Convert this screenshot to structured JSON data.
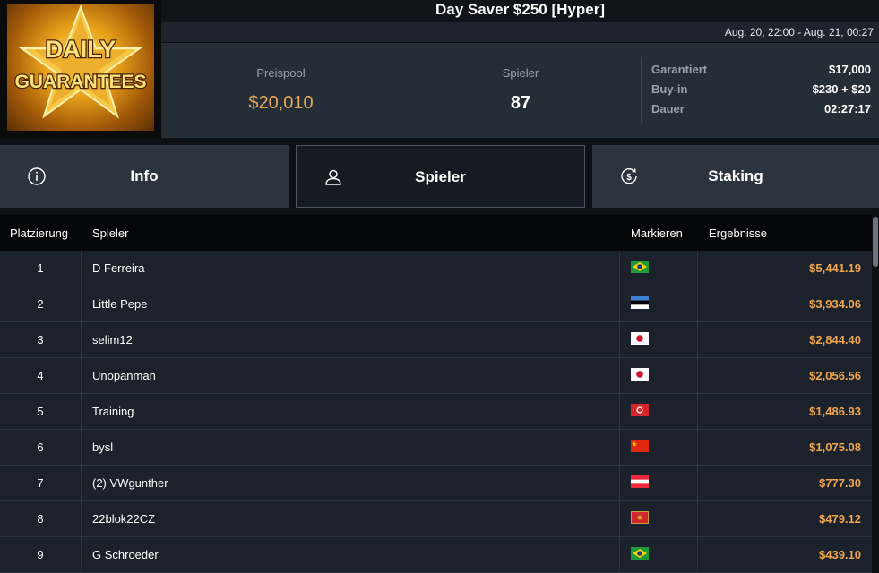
{
  "logo": {
    "line1": "DAILY",
    "line2": "GUARANTEES"
  },
  "title": "Day Saver $250 [Hyper]",
  "date_range": "Aug. 20, 22:00 - Aug. 21, 00:27",
  "stats": {
    "prize_label": "Preispool",
    "prize_value": "$20,010",
    "players_label": "Spieler",
    "players_value": "87"
  },
  "details": [
    {
      "label": "Garantiert",
      "value": "$17,000"
    },
    {
      "label": "Buy-in",
      "value": "$230 + $20"
    },
    {
      "label": "Dauer",
      "value": "02:27:17"
    }
  ],
  "tabs": [
    {
      "label": "Info",
      "icon": "info-icon"
    },
    {
      "label": "Spieler",
      "icon": "user-icon",
      "active": true
    },
    {
      "label": "Staking",
      "icon": "dollar-refresh-icon"
    }
  ],
  "table": {
    "headers": {
      "place": "Platzierung",
      "player": "Spieler",
      "mark": "Markieren",
      "results": "Ergebnisse"
    },
    "rows": [
      {
        "place": "1",
        "name": "D Ferreira",
        "flag": "BR",
        "result": "$5,441.19"
      },
      {
        "place": "2",
        "name": "Little Pepe",
        "flag": "EE",
        "result": "$3,934.06"
      },
      {
        "place": "3",
        "name": "selim12",
        "flag": "JP",
        "result": "$2,844.40"
      },
      {
        "place": "4",
        "name": "Unopanman",
        "flag": "JP",
        "result": "$2,056.56"
      },
      {
        "place": "5",
        "name": "Training",
        "flag": "HK",
        "result": "$1,486.93"
      },
      {
        "place": "6",
        "name": "bysl",
        "flag": "CN",
        "result": "$1,075.08"
      },
      {
        "place": "7",
        "name": "(2) VWgunther",
        "flag": "AT",
        "result": "$777.30"
      },
      {
        "place": "8",
        "name": "22blok22CZ",
        "flag": "ME",
        "result": "$479.12"
      },
      {
        "place": "9",
        "name": "G Schroeder",
        "flag": "BR",
        "result": "$439.10"
      }
    ]
  },
  "colors": {
    "accent": "#f0a650",
    "prize": "#e7a85a"
  }
}
